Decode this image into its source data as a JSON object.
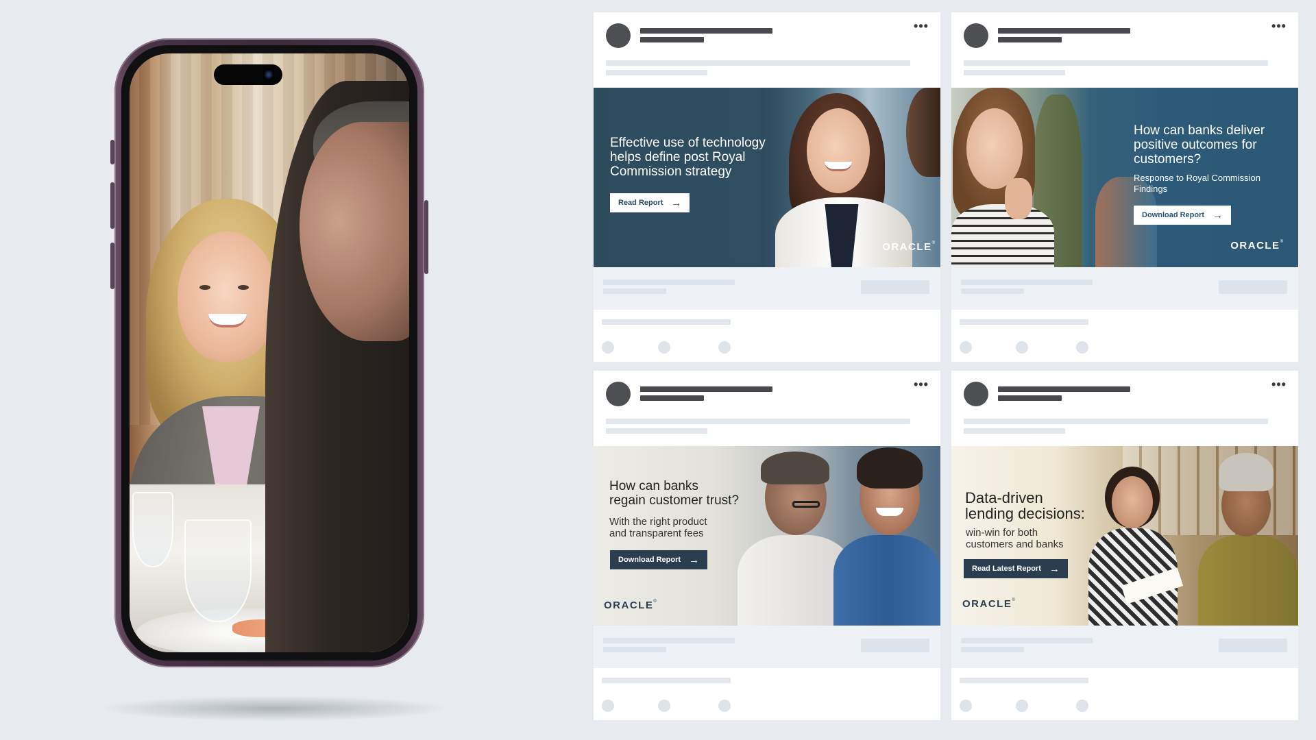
{
  "ads": [
    {
      "headline": [
        "Effective use of technology",
        "helps define post Royal",
        "Commission strategy"
      ],
      "subhead": [],
      "cta": "Read Report",
      "brand": "ORACLE"
    },
    {
      "headline": [
        "How can banks deliver",
        "positive outcomes for",
        "customers?"
      ],
      "subhead": [
        "Response to Royal Commission",
        "Findings"
      ],
      "cta": "Download Report",
      "brand": "ORACLE"
    },
    {
      "headline": [
        "How can banks",
        "regain customer trust?"
      ],
      "subhead": [
        "With the right product",
        "and transparent fees"
      ],
      "cta": "Download Report",
      "brand": "ORACLE"
    },
    {
      "headline": [
        "Data-driven",
        "lending decisions:"
      ],
      "subhead": [
        "win-win for both",
        "customers and banks"
      ],
      "cta": "Read Latest Report",
      "brand": "ORACLE"
    }
  ],
  "icons": {
    "more": "more-horizontal-icon",
    "cta_arrow": "arrow-right-icon"
  },
  "glyphs": {
    "more": "•••",
    "arrow": "→",
    "trademark": "®"
  },
  "colors": {
    "page_background": "#e7ebef",
    "ad_navy": "#2e4b5e",
    "cta_dark": "#2b3e50",
    "phone_frame": "#3c2b39"
  }
}
